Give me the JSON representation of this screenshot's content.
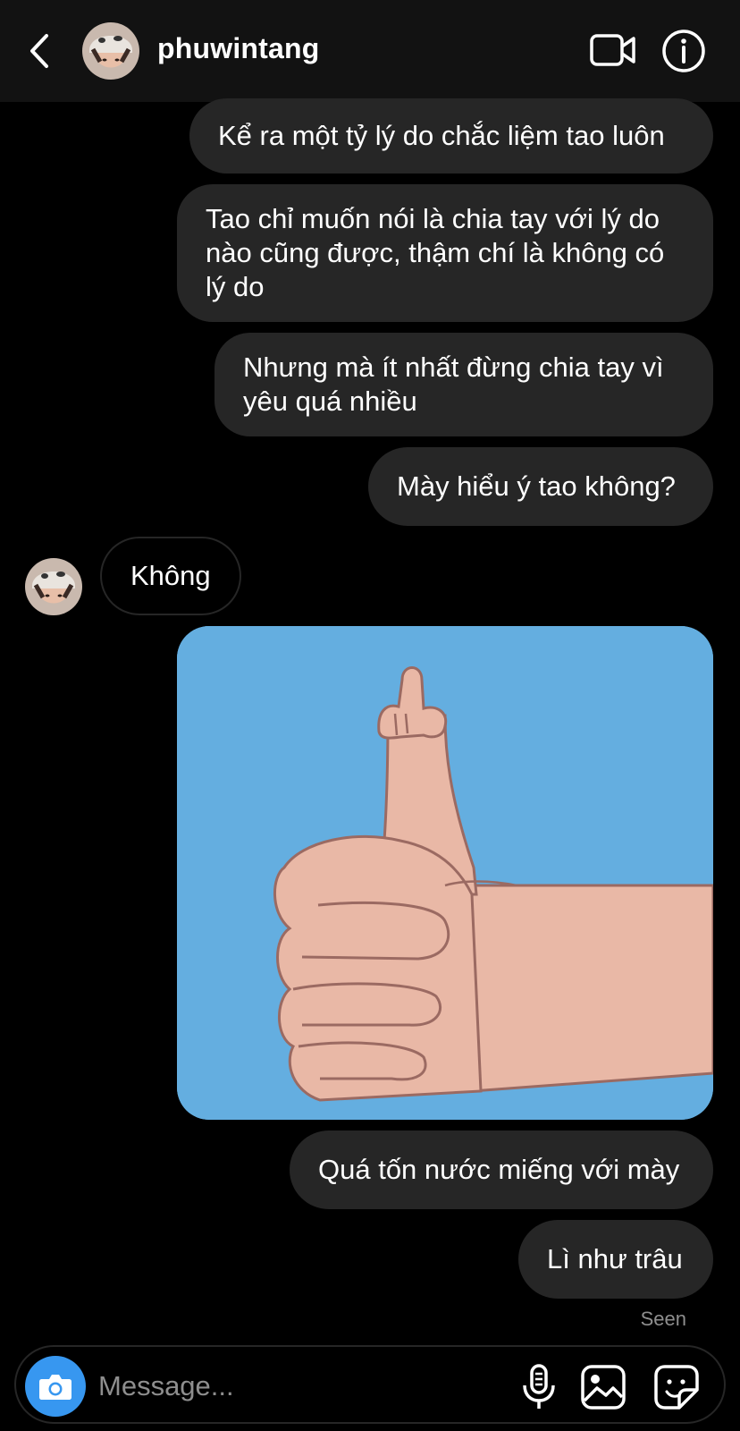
{
  "header": {
    "username": "phuwintang",
    "back_icon": "chevron-left-icon",
    "video_icon": "video-camera-icon",
    "info_icon": "info-icon"
  },
  "messages": [
    {
      "sender": "me",
      "text": "Kể ra một tỷ lý do chắc liệm tao luôn"
    },
    {
      "sender": "me",
      "lines": [
        "Tao chỉ muốn nói là chia tay với lý do",
        "nào cũng được, thậm chí là không có",
        "lý do"
      ]
    },
    {
      "sender": "me",
      "lines": [
        "Nhưng mà ít nhất đừng chia tay vì",
        "yêu quá nhiều"
      ]
    },
    {
      "sender": "me",
      "text": "Mày hiểu ý tao không?"
    },
    {
      "sender": "phuwintang",
      "text": "Không"
    },
    {
      "sender": "me",
      "type": "photo",
      "description_icon": "thumbs-up-middle-finger-image"
    },
    {
      "sender": "me",
      "text": "Quá tốn nước miếng với mày"
    },
    {
      "sender": "me",
      "text": "Lì như trâu"
    }
  ],
  "seen_label": "Seen",
  "composer": {
    "placeholder": "Message...",
    "camera_icon": "camera-icon",
    "mic_icon": "microphone-icon",
    "gallery_icon": "image-icon",
    "sticker_icon": "sticker-icon"
  },
  "colors": {
    "background": "#000000",
    "header": "#121212",
    "bubble": "#262626",
    "accent": "#3797f0",
    "muted": "#8e8e8e",
    "photo_bg": "#64aee0",
    "skin": "#e9b8a6"
  }
}
